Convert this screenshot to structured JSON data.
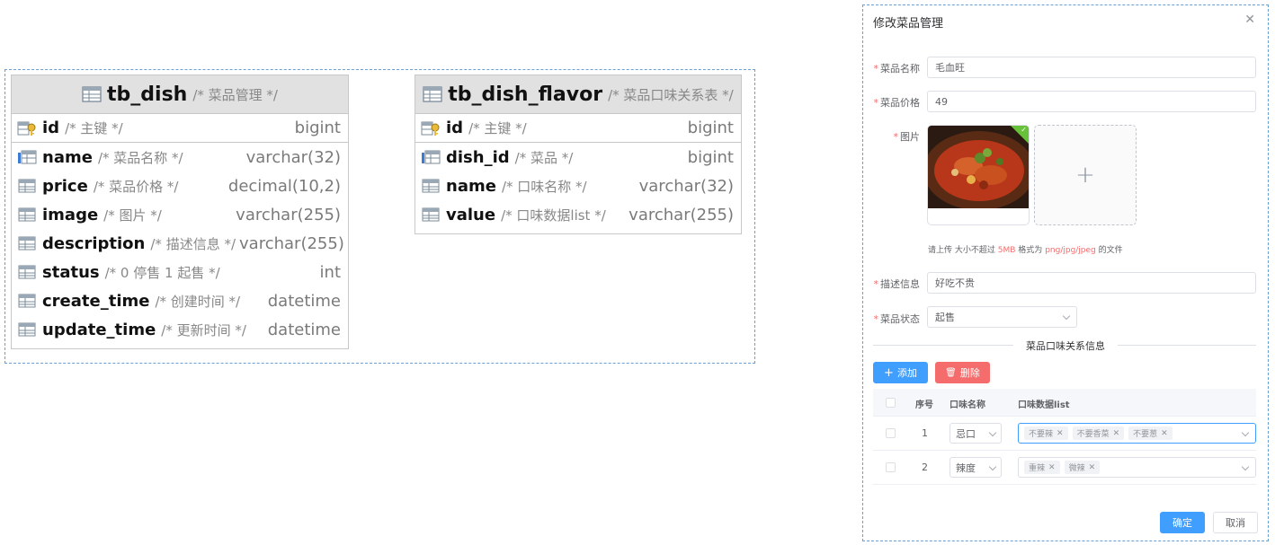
{
  "tables": [
    {
      "name": "tb_dish",
      "comment": "/* 菜品管理 */",
      "columns": [
        {
          "name": "id",
          "comment": "/* 主键 */",
          "type": "bigint",
          "icon": "primary-key-icon"
        },
        {
          "name": "name",
          "comment": "/* 菜品名称 */",
          "type": "varchar(32)",
          "icon": "unique-column-icon"
        },
        {
          "name": "price",
          "comment": "/* 菜品价格 */",
          "type": "decimal(10,2)",
          "icon": "column-icon"
        },
        {
          "name": "image",
          "comment": "/* 图片 */",
          "type": "varchar(255)",
          "icon": "column-icon"
        },
        {
          "name": "description",
          "comment": "/* 描述信息 */",
          "type": "varchar(255)",
          "icon": "column-icon"
        },
        {
          "name": "status",
          "comment": "/* 0 停售 1 起售 */",
          "type": "int",
          "icon": "column-icon"
        },
        {
          "name": "create_time",
          "comment": "/* 创建时间 */",
          "type": "datetime",
          "icon": "column-icon"
        },
        {
          "name": "update_time",
          "comment": "/* 更新时间 */",
          "type": "datetime",
          "icon": "column-icon"
        }
      ]
    },
    {
      "name": "tb_dish_flavor",
      "comment": "/* 菜品口味关系表 */",
      "columns": [
        {
          "name": "id",
          "comment": "/* 主键 */",
          "type": "bigint",
          "icon": "primary-key-icon"
        },
        {
          "name": "dish_id",
          "comment": "/* 菜品 */",
          "type": "bigint",
          "icon": "unique-column-icon"
        },
        {
          "name": "name",
          "comment": "/* 口味名称 */",
          "type": "varchar(32)",
          "icon": "column-icon"
        },
        {
          "name": "value",
          "comment": "/* 口味数据list */",
          "type": "varchar(255)",
          "icon": "column-icon"
        }
      ]
    }
  ],
  "dialog": {
    "title": "修改菜品管理",
    "close_icon": "close-icon",
    "name_label": "菜品名称",
    "name_value": "毛血旺",
    "price_label": "菜品价格",
    "price_value": "49",
    "image_label": "图片",
    "upload_hint_prefix": "请上传 大小不超过",
    "upload_hint_size": "5MB",
    "upload_hint_mid": "格式为",
    "upload_hint_formats": "png/jpg/jpeg",
    "upload_hint_suffix": "的文件",
    "description_label": "描述信息",
    "description_value": "好吃不贵",
    "status_label": "菜品状态",
    "status_value": "起售",
    "flavor_section_title": "菜品口味关系信息",
    "add_button": "添加",
    "delete_button": "删除",
    "table_headers": {
      "index": "序号",
      "flavor_name": "口味名称",
      "flavor_list": "口味数据list"
    },
    "rows": [
      {
        "index": "1",
        "flavor_name": "忌口",
        "tags": [
          "不要辣",
          "不要香菜",
          "不要葱"
        ]
      },
      {
        "index": "2",
        "flavor_name": "辣度",
        "tags": [
          "重辣",
          "微辣"
        ]
      }
    ],
    "confirm_button": "确定",
    "cancel_button": "取消",
    "colors": {
      "primary": "#409eff",
      "danger": "#f56c6c",
      "border_dashed": "#6a9fd4"
    }
  }
}
